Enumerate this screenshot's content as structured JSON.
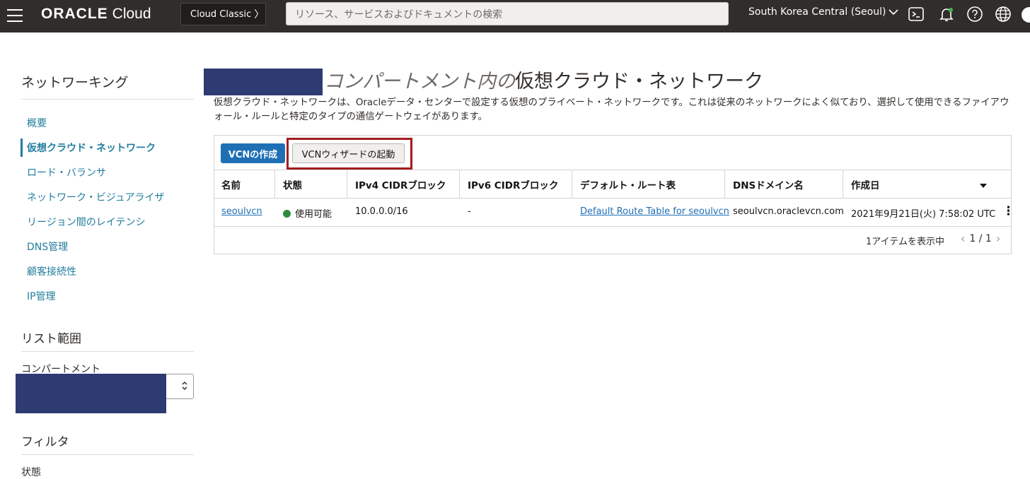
{
  "header": {
    "brand": "ORACLE",
    "product": "Cloud",
    "classic_button": "Cloud Classic",
    "search_placeholder": "リソース、サービスおよびドキュメントの検索",
    "region": "South Korea Central (Seoul)",
    "icons": [
      "menu-icon",
      "chevron-right-icon",
      "chevron-down-icon",
      "terminal-icon",
      "bell-icon",
      "help-icon",
      "globe-icon"
    ]
  },
  "sidebar": {
    "title": "ネットワーキング",
    "items": [
      {
        "label": "概要"
      },
      {
        "label": "仮想クラウド・ネットワーク",
        "active": true
      },
      {
        "label": "ロード・バランサ"
      },
      {
        "label": "ネットワーク・ビジュアライザ"
      },
      {
        "label": "リージョン間のレイテンシ"
      },
      {
        "label": "DNS管理"
      },
      {
        "label": "顧客接続性"
      },
      {
        "label": "IP管理"
      }
    ],
    "scope_title": "リスト範囲",
    "compartment_label": "コンパートメント",
    "filter_title": "フィルタ",
    "status_label": "状態"
  },
  "main": {
    "title_italic": "コンパートメント内の",
    "title": "仮想クラウド・ネットワーク",
    "description": "仮想クラウド・ネットワークは、Oracleデータ・センターで設定する仮想のプライベート・ネットワークです。これは従来のネットワークによく似ており、選択して使用できるファイアウォール・ルールと特定のタイプの通信ゲートウェイがあります。",
    "create_button": "VCNの作成",
    "wizard_button": "VCNウィザードの起動",
    "table": {
      "headers": [
        "名前",
        "状態",
        "IPv4 CIDRブロック",
        "IPv6 CIDRブロック",
        "デフォルト・ルート表",
        "DNSドメイン名",
        "作成日"
      ],
      "rows": [
        {
          "name": "seoulvcn",
          "status": "使用可能",
          "ipv4": "10.0.0.0/16",
          "ipv6": "-",
          "route_table": "Default Route Table for seoulvcn",
          "dns": "seoulvcn.oraclevcn.com",
          "created": "2021年9月21日(火) 7:58:02 UTC"
        }
      ],
      "status_color": "#2e8b3e"
    },
    "pager_text": "1アイテムを表示中",
    "pager_pages": "1 / 1"
  },
  "colors": {
    "topbar": "#312d2a",
    "link": "#227e9e",
    "primary": "#1f6fb5",
    "highlight": "#a51c1f",
    "redaction": "#2e3a72"
  }
}
